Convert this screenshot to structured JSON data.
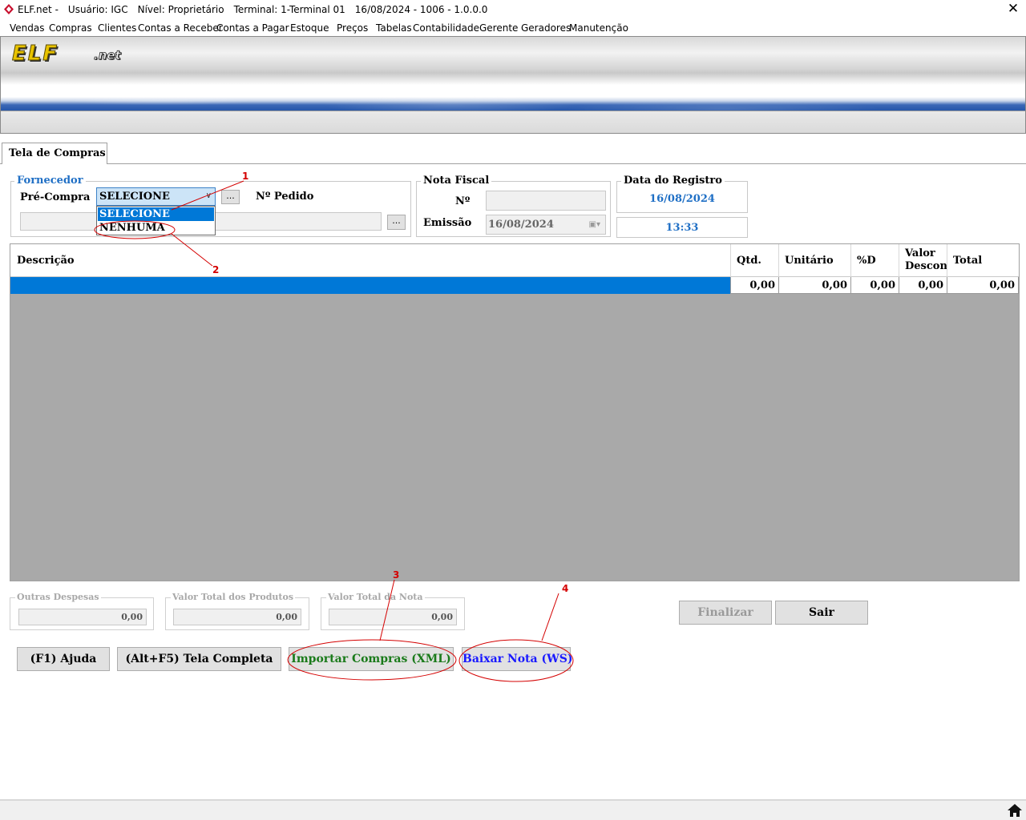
{
  "window": {
    "title_parts": [
      "ELF.net -",
      "Usuário: IGC",
      "Nível: Proprietário",
      "Terminal: 1-Terminal 01",
      "16/08/2024 - 1006 - 1.0.0.0"
    ],
    "close_glyph": "✕"
  },
  "menu": [
    "Vendas",
    "Compras",
    "Clientes",
    "Contas a Receber",
    "Contas a Pagar",
    "Estoque",
    "Preços",
    "Tabelas",
    "Contabilidade",
    "Gerente",
    "Geradores",
    "Manutenção"
  ],
  "banner": {
    "logo": "ELF",
    "logo_suffix": ".net"
  },
  "tab": {
    "label": "Tela de Compras"
  },
  "fornecedor": {
    "legend": "Fornecedor",
    "pre_compra_label": "Pré-Compra",
    "pre_compra_value": "SELECIONE",
    "options": [
      "SELECIONE",
      "NENHUMA"
    ],
    "lookup_button": "...",
    "pedido_label": "Nº Pedido"
  },
  "nota_fiscal": {
    "legend": "Nota Fiscal",
    "numero_label": "Nº",
    "numero_value": "",
    "emissao_label": "Emissão",
    "emissao_value": "16/08/2024"
  },
  "registro": {
    "legend": "Data do Registro",
    "date": "16/08/2024",
    "time": "13:33"
  },
  "grid": {
    "headers": {
      "descricao": "Descrição",
      "qtd": "Qtd.",
      "unitario": "Unitário",
      "pct_desc": "%D",
      "valor_desconto_1": "Valor",
      "valor_desconto_2": "Descon",
      "total": "Total"
    },
    "row": {
      "qtd": "0,00",
      "unitario": "0,00",
      "pct_desc": "0,00",
      "valor_desconto": "0,00",
      "total": "0,00"
    }
  },
  "totals": {
    "outras_label": "Outras Despesas",
    "outras_value": "0,00",
    "produtos_label": "Valor Total dos Produtos",
    "produtos_value": "0,00",
    "nota_label": "Valor Total da Nota",
    "nota_value": "0,00"
  },
  "buttons": {
    "finalizar": "Finalizar",
    "sair": "Sair",
    "ajuda": "(F1) Ajuda",
    "tela_completa": "(Alt+F5) Tela Completa",
    "importar": "Importar Compras (XML)",
    "baixar": "Baixar Nota (WS)"
  },
  "annotations": {
    "n1": "1",
    "n2": "2",
    "n3": "3",
    "n4": "4"
  },
  "colors": {
    "selection_blue": "#0078d7",
    "legend_blue": "#1f6fc5",
    "import_green": "#1a7a1a",
    "baixar_blue": "#1a1aff",
    "annotation_red": "#d40000",
    "grid_gray": "#a9a9a9"
  }
}
